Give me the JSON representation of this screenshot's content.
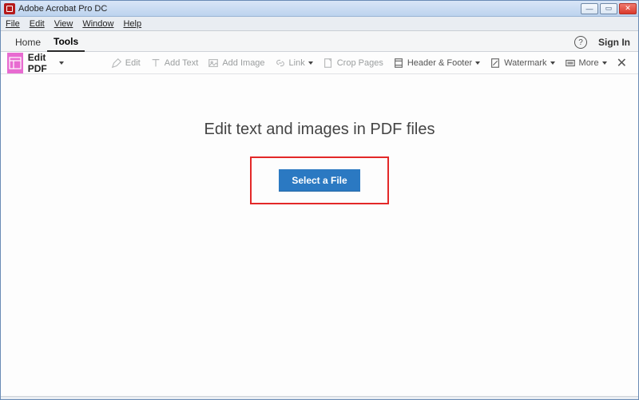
{
  "titlebar": {
    "title": "Adobe Acrobat Pro DC"
  },
  "menu": {
    "file": "File",
    "edit": "Edit",
    "view": "View",
    "window": "Window",
    "help": "Help"
  },
  "tabs": {
    "home": "Home",
    "tools": "Tools"
  },
  "header": {
    "help_glyph": "?",
    "signin": "Sign In"
  },
  "toolbar": {
    "name": "Edit PDF",
    "edit": "Edit",
    "add_text": "Add Text",
    "add_image": "Add Image",
    "link": "Link",
    "crop": "Crop Pages",
    "header_footer": "Header & Footer",
    "watermark": "Watermark",
    "more": "More"
  },
  "content": {
    "headline": "Edit text and images in PDF files",
    "select_btn": "Select a File"
  }
}
